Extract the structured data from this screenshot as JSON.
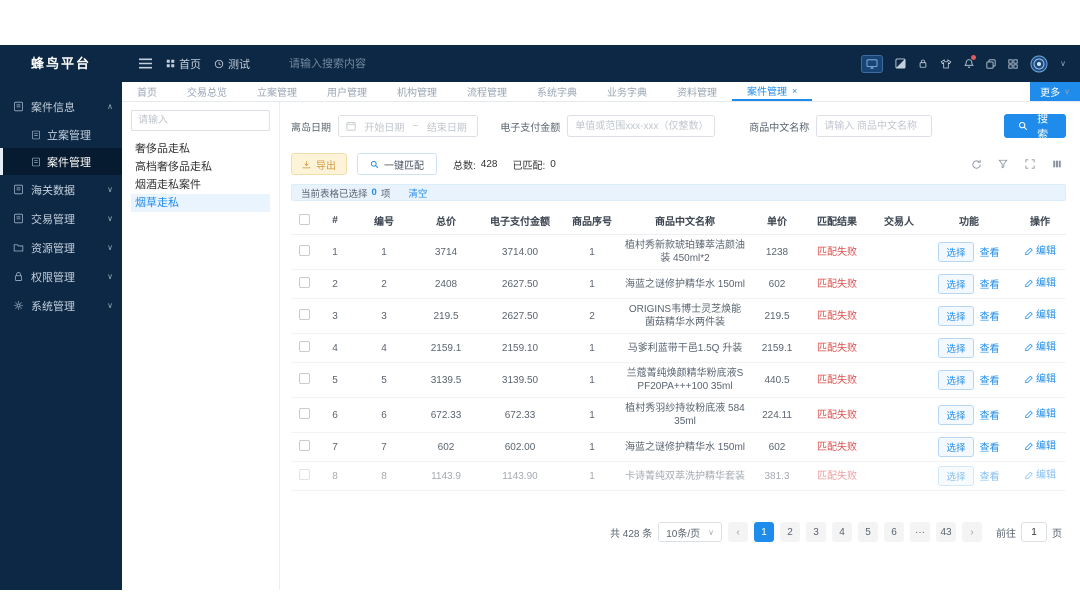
{
  "colors": {
    "accent": "#1f8ceb",
    "danger": "#d9534f",
    "warning": "#d29a3d",
    "sidebar_bg": "#0d2844"
  },
  "icons": {
    "close": "×",
    "caret_down": "∨",
    "caret_up": "∧",
    "chev_down": "⌄",
    "ellipsis": "···",
    "prev": "‹",
    "next": "›"
  },
  "sidebar": {
    "logo": "蜂鸟平台",
    "items": [
      {
        "label": "案件信息"
      },
      {
        "label": "立案管理"
      },
      {
        "label": "案件管理"
      },
      {
        "label": "海关数据"
      },
      {
        "label": "交易管理"
      },
      {
        "label": "资源管理"
      },
      {
        "label": "权限管理"
      },
      {
        "label": "系统管理"
      }
    ]
  },
  "navbar": {
    "home": "首页",
    "test": "测试",
    "search_placeholder": "请输入搜索内容"
  },
  "tabs": {
    "items": [
      {
        "label": "首页"
      },
      {
        "label": "交易总览"
      },
      {
        "label": "立案管理"
      },
      {
        "label": "用户管理"
      },
      {
        "label": "机构管理"
      },
      {
        "label": "流程管理"
      },
      {
        "label": "系统字典"
      },
      {
        "label": "业务字典"
      },
      {
        "label": "资料管理"
      },
      {
        "label": "案件管理"
      }
    ],
    "more_label": "更多"
  },
  "left_panel": {
    "search_placeholder": "请输入",
    "items": [
      {
        "label": "奢侈品走私"
      },
      {
        "label": "高档奢侈品走私"
      },
      {
        "label": "烟酒走私案件"
      },
      {
        "label": "烟草走私"
      }
    ]
  },
  "filters": {
    "date_label": "离岛日期",
    "date_start_placeholder": "开始日期",
    "date_separator": "~",
    "date_end_placeholder": "结束日期",
    "amount_label": "电子支付金额",
    "amount_placeholder": "单值或范围xxx-xxx（仅整数）",
    "name_label": "商品中文名称",
    "name_placeholder": "请输入 商品中文名称",
    "search_button": "搜索"
  },
  "toolbar": {
    "export_label": "导出",
    "match_label": "一键匹配",
    "total_label": "总数:",
    "total_value": "428",
    "matched_label": "已匹配:",
    "matched_value": "0"
  },
  "selection_bar": {
    "prefix": "当前表格已选择",
    "count": "0",
    "suffix": "项",
    "clear_label": "清空"
  },
  "table": {
    "headers": [
      "#",
      "编号",
      "总价",
      "电子支付金额",
      "商品序号",
      "商品中文名称",
      "单价",
      "匹配结果",
      "交易人",
      "功能",
      "操作"
    ],
    "select_label": "选择",
    "view_label": "查看",
    "edit_label": "编辑",
    "rows": [
      {
        "idx": "1",
        "no": "1",
        "total": "3714",
        "epay": "3714.00",
        "seq": "1",
        "name": "植村秀新款琥珀臻萃洁颜油装 450ml*2",
        "unit": "1238",
        "result": "匹配失败",
        "trader": ""
      },
      {
        "idx": "2",
        "no": "2",
        "total": "2408",
        "epay": "2627.50",
        "seq": "1",
        "name": "海蓝之谜修护精华水 150ml",
        "unit": "602",
        "result": "匹配失败",
        "trader": ""
      },
      {
        "idx": "3",
        "no": "3",
        "total": "219.5",
        "epay": "2627.50",
        "seq": "2",
        "name": "ORIGINS韦博士灵芝焕能菌菇精华水两件装",
        "unit": "219.5",
        "result": "匹配失败",
        "trader": ""
      },
      {
        "idx": "4",
        "no": "4",
        "total": "2159.1",
        "epay": "2159.10",
        "seq": "1",
        "name": "马爹利蓝带干邑1.5Q 升装",
        "unit": "2159.1",
        "result": "匹配失败",
        "trader": ""
      },
      {
        "idx": "5",
        "no": "5",
        "total": "3139.5",
        "epay": "3139.50",
        "seq": "1",
        "name": "兰蔻菁纯焕颜精华粉底液SPF20PA+++100 35ml",
        "unit": "440.5",
        "result": "匹配失败",
        "trader": ""
      },
      {
        "idx": "6",
        "no": "6",
        "total": "672.33",
        "epay": "672.33",
        "seq": "1",
        "name": "植村秀羽纱持妆粉底液 584 35ml",
        "unit": "224.11",
        "result": "匹配失败",
        "trader": ""
      },
      {
        "idx": "7",
        "no": "7",
        "total": "602",
        "epay": "602.00",
        "seq": "1",
        "name": "海蓝之谜修护精华水 150ml",
        "unit": "602",
        "result": "匹配失败",
        "trader": ""
      },
      {
        "idx": "8",
        "no": "8",
        "total": "1143.9",
        "epay": "1143.90",
        "seq": "1",
        "name": "卡诗菁纯双萃洗护精华套装",
        "unit": "381.3",
        "result": "匹配失败",
        "trader": ""
      }
    ]
  },
  "pagination": {
    "total_text": "共 428 条",
    "page_size_text": "10条/页",
    "pages": [
      "1",
      "2",
      "3",
      "4",
      "5",
      "6",
      "···",
      "43"
    ],
    "goto_label": "前往",
    "goto_value": "1",
    "goto_unit": "页"
  }
}
